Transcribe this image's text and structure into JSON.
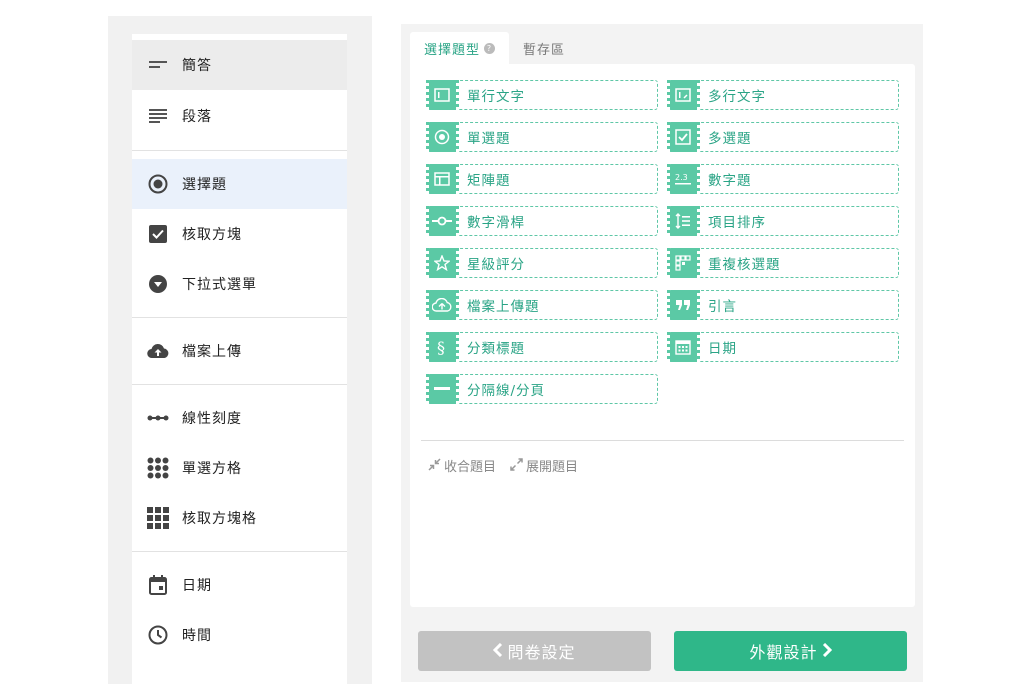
{
  "left_menu": {
    "items": [
      {
        "label": "簡答",
        "icon": "short-answer-icon"
      },
      {
        "label": "段落",
        "icon": "paragraph-icon"
      },
      {
        "label": "選擇題",
        "icon": "radio-icon"
      },
      {
        "label": "核取方塊",
        "icon": "checkbox-icon"
      },
      {
        "label": "下拉式選單",
        "icon": "dropdown-icon"
      },
      {
        "label": "檔案上傳",
        "icon": "cloud-upload-icon"
      },
      {
        "label": "線性刻度",
        "icon": "linear-scale-icon"
      },
      {
        "label": "單選方格",
        "icon": "radio-grid-icon"
      },
      {
        "label": "核取方塊格",
        "icon": "checkbox-grid-icon"
      },
      {
        "label": "日期",
        "icon": "calendar-icon"
      },
      {
        "label": "時間",
        "icon": "clock-icon"
      }
    ]
  },
  "tabs": {
    "select": "選擇題型",
    "staging": "暫存區"
  },
  "question_types": [
    {
      "label": "單行文字",
      "icon": "single-line-text-icon"
    },
    {
      "label": "多行文字",
      "icon": "multi-line-text-icon"
    },
    {
      "label": "單選題",
      "icon": "radio-icon"
    },
    {
      "label": "多選題",
      "icon": "checkbox-icon"
    },
    {
      "label": "矩陣題",
      "icon": "matrix-icon"
    },
    {
      "label": "數字題",
      "icon": "number-icon"
    },
    {
      "label": "數字滑桿",
      "icon": "slider-icon"
    },
    {
      "label": "項目排序",
      "icon": "sort-icon"
    },
    {
      "label": "星級評分",
      "icon": "star-icon"
    },
    {
      "label": "重複核選題",
      "icon": "repeat-check-icon"
    },
    {
      "label": "檔案上傳題",
      "icon": "cloud-upload-icon"
    },
    {
      "label": "引言",
      "icon": "quote-icon"
    },
    {
      "label": "分類標題",
      "icon": "section-icon"
    },
    {
      "label": "日期",
      "icon": "calendar-icon"
    },
    {
      "label": "分隔線/分頁",
      "icon": "divider-icon"
    }
  ],
  "actions": {
    "collapse": "收合題目",
    "expand": "展開題目"
  },
  "footer": {
    "back": "問卷設定",
    "next": "外觀設計"
  },
  "colors": {
    "accent": "#2aa486",
    "button_green": "#2fb789",
    "icon_green": "#5bc9a5",
    "disabled": "#c2c2c2"
  }
}
